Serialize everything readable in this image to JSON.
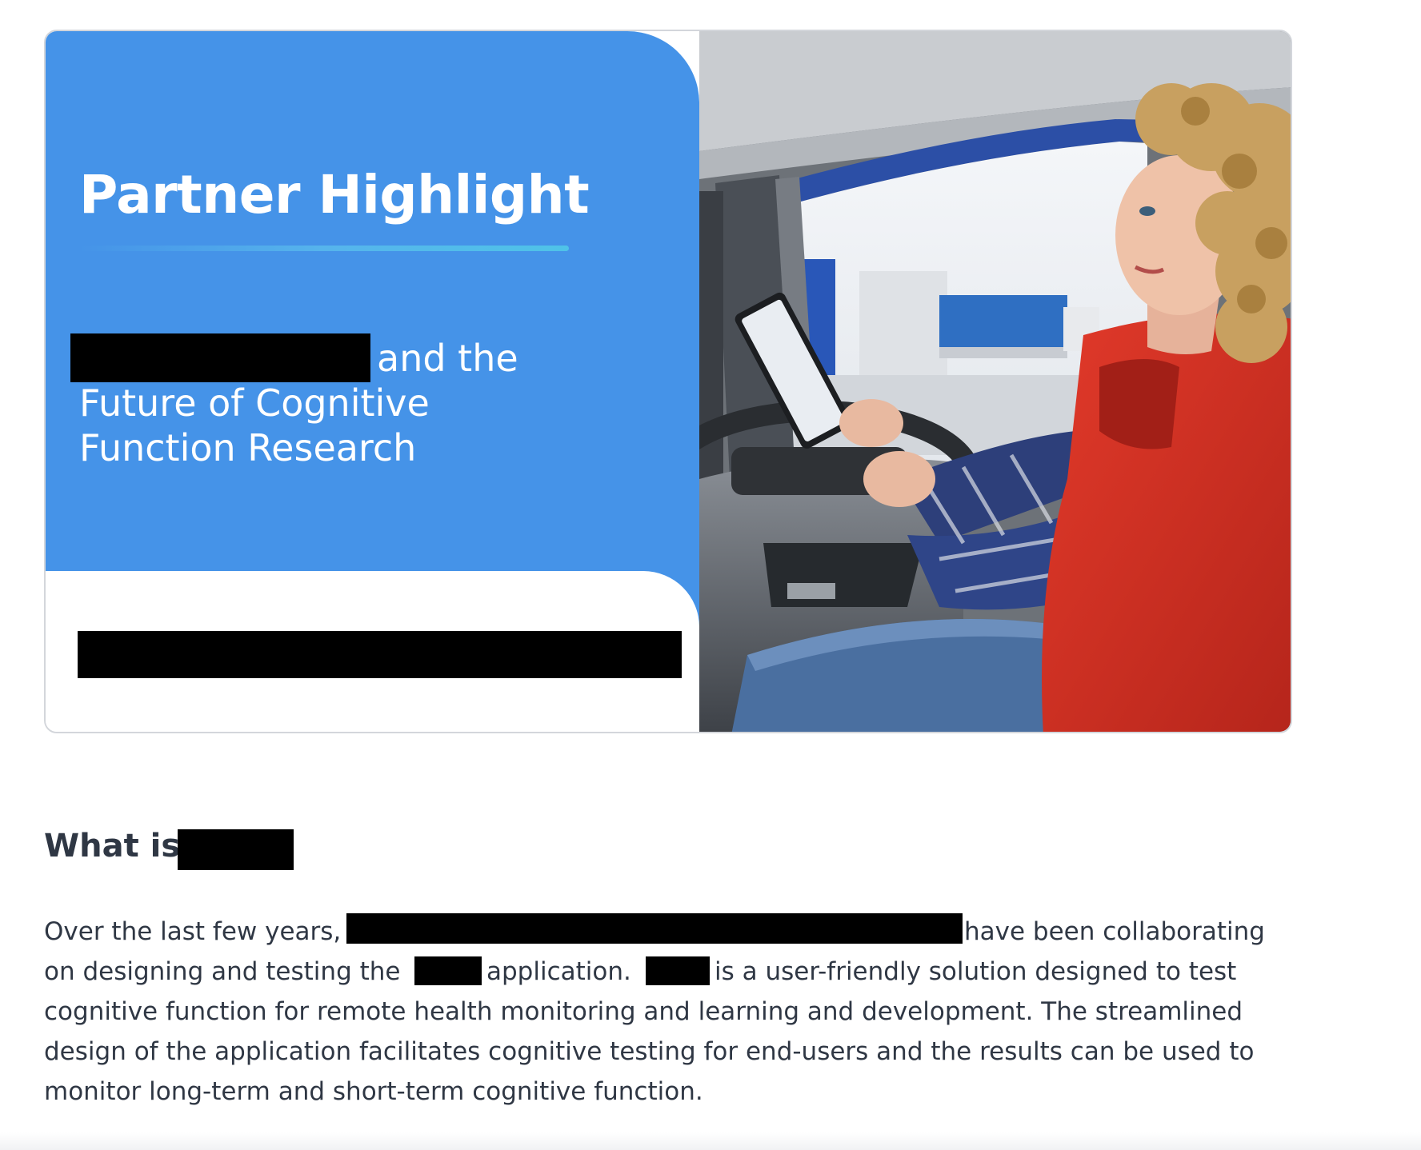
{
  "hero": {
    "title": "Partner Highlight",
    "subtitle_line1": "and the",
    "subtitle_line2": "Future of Cognitive",
    "subtitle_line3": "Function Research",
    "colors": {
      "panel_blue": "#4593e8",
      "rule_cyan": "#4fc3e8",
      "redaction": "#000000"
    },
    "photo_description_icon": "person-using-tablet-in-truck-photo"
  },
  "article": {
    "heading": "What is",
    "para": {
      "l1_a": "Over the last few years,",
      "l1_b": "have been collaborating",
      "l2_a": "on designing and testing the",
      "l2_b": "application.",
      "l2_c": "is a user-friendly solution designed to test",
      "l3": "cognitive function for remote health monitoring and learning and development. The streamlined",
      "l4": "design of the application facilitates cognitive testing for end-users and the results can be used to",
      "l5": "monitor long-term and short-term cognitive function."
    }
  }
}
